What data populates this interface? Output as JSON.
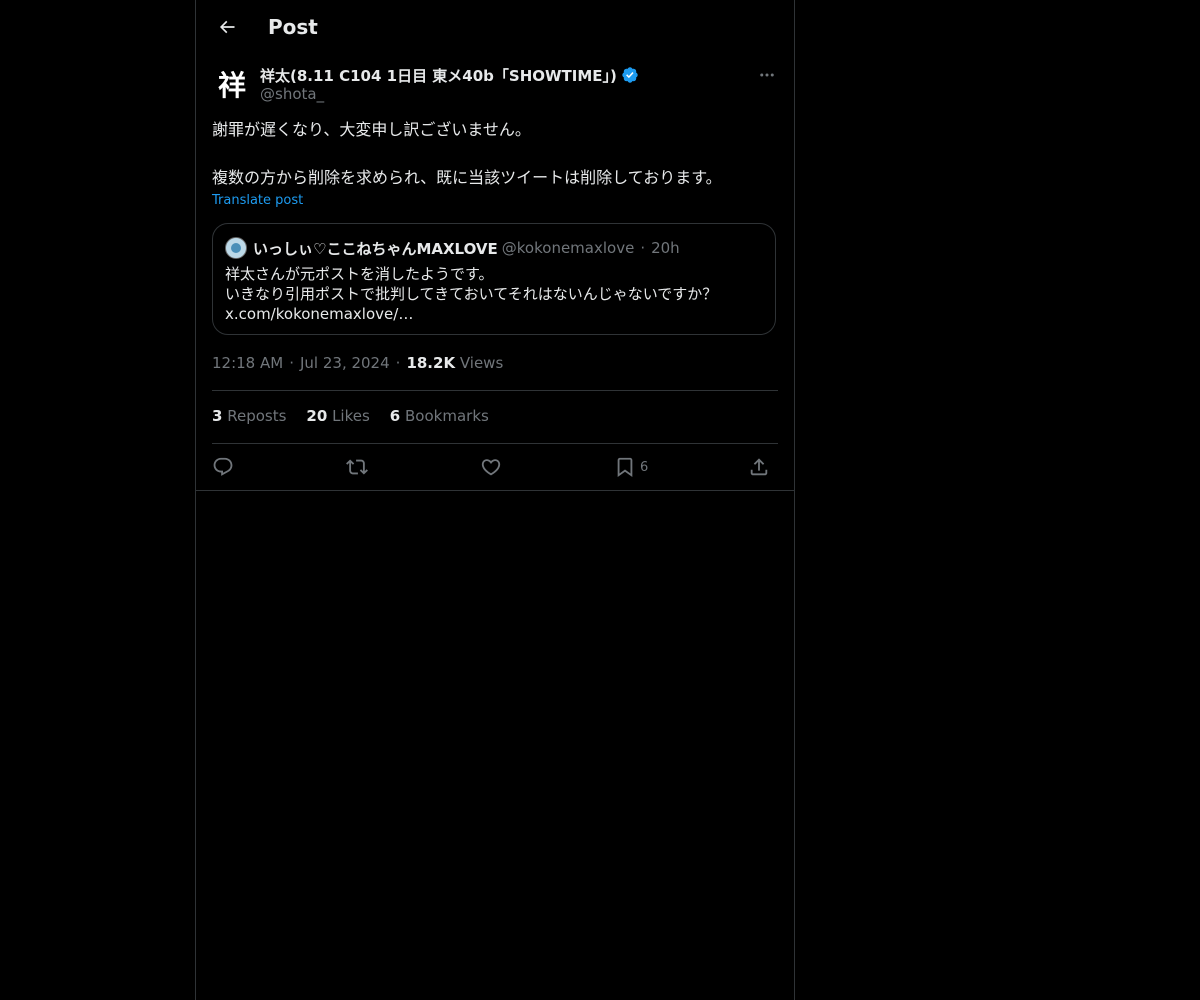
{
  "header": {
    "title": "Post"
  },
  "author": {
    "avatar_text": "祥",
    "name": "祥太(8.11 C104 1日目 東メ40b「SHOWTIME」)",
    "handle": "@shota_"
  },
  "post": {
    "line1": "謝罪が遅くなり、大変申し訳ございません。",
    "line2": "複数の方から削除を求められ、既に当該ツイートは削除しております。",
    "translate": "Translate post"
  },
  "quote": {
    "name": "いっしぃ♡ここねちゃんMAXLOVE",
    "handle": "@kokonemaxlove",
    "dot": "·",
    "time": "20h",
    "line1": "祥太さんが元ポストを消したようです。",
    "line2": "いきなり引用ポストで批判してきておいてそれはないんじゃないですか？",
    "line3": "x.com/kokonemaxlove/…"
  },
  "meta": {
    "time": "12:18 AM",
    "sep": "·",
    "date": "Jul 23, 2024",
    "views_count": "18.2K",
    "views_label": "Views"
  },
  "stats": {
    "reposts_count": "3",
    "reposts_label": "Reposts",
    "likes_count": "20",
    "likes_label": "Likes",
    "bookmarks_count": "6",
    "bookmarks_label": "Bookmarks"
  },
  "actions": {
    "bookmark_count": "6",
    "icons": [
      "reply-icon",
      "repost-icon",
      "like-icon",
      "bookmark-icon",
      "share-icon"
    ]
  },
  "colors": {
    "background": "#000000",
    "text": "#e7e9ea",
    "secondary": "#71767b",
    "accent": "#1d9bf0",
    "border": "#2f3336"
  }
}
